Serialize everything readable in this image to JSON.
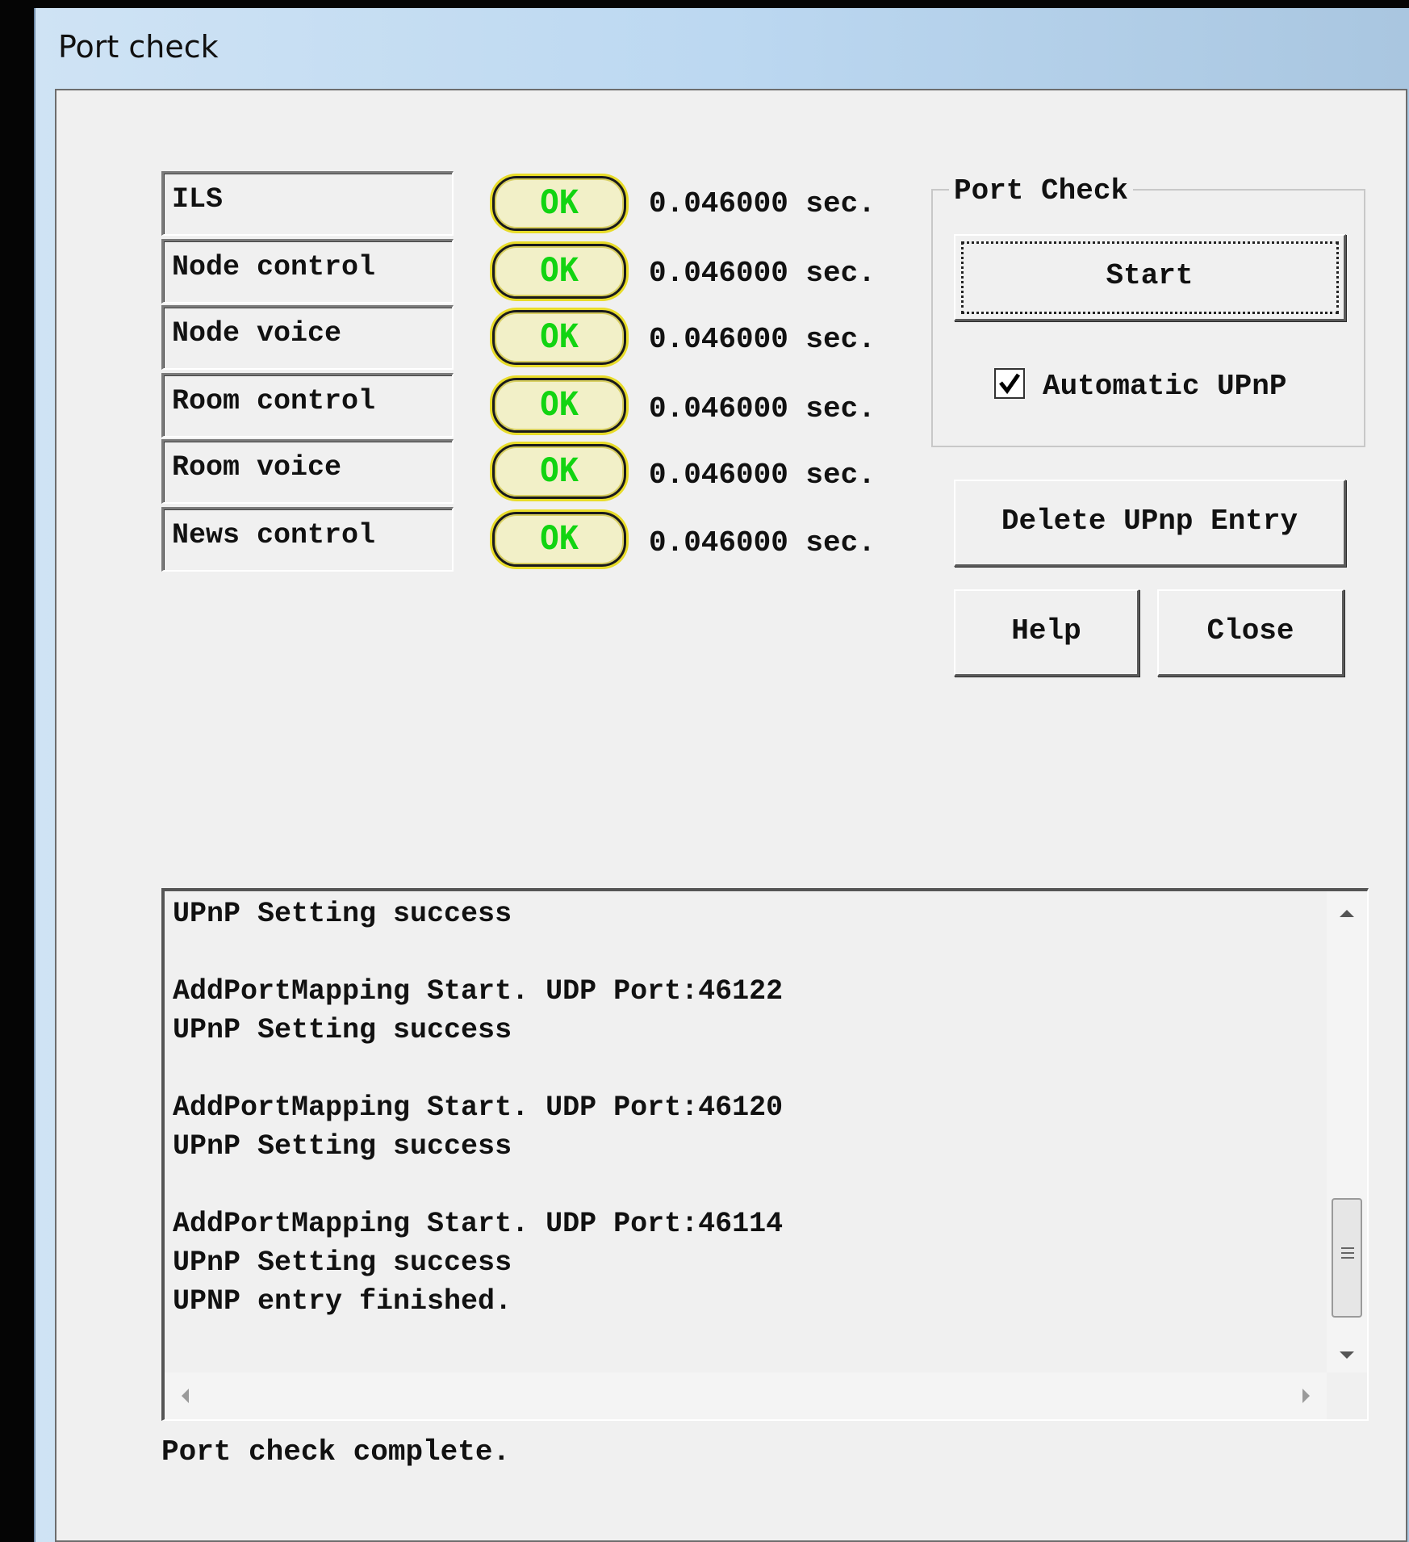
{
  "window": {
    "title": "Port check"
  },
  "services": [
    {
      "name": "ILS",
      "status": "OK",
      "time": "0.046000 sec."
    },
    {
      "name": "Node control",
      "status": "OK",
      "time": "0.046000 sec."
    },
    {
      "name": "Node voice",
      "status": "OK",
      "time": "0.046000 sec."
    },
    {
      "name": "Room control",
      "status": "OK",
      "time": "0.046000 sec."
    },
    {
      "name": "Room voice",
      "status": "OK",
      "time": "0.046000 sec."
    },
    {
      "name": "News control",
      "status": "OK",
      "time": "0.046000 sec."
    }
  ],
  "port_check_group": {
    "label": "Port Check",
    "start_label": "Start",
    "automatic_upnp_label": "Automatic UPnP",
    "automatic_upnp_checked": true
  },
  "buttons": {
    "delete_upnp": "Delete UPnp Entry",
    "help": "Help",
    "close": "Close"
  },
  "log": {
    "lines": [
      "UPnP Setting success",
      "",
      "AddPortMapping Start. UDP Port:46122",
      "UPnP Setting success",
      "",
      "AddPortMapping Start. UDP Port:46120",
      "UPnP Setting success",
      "",
      "AddPortMapping Start. UDP Port:46114",
      "UPnP Setting success",
      "UPNP entry finished."
    ]
  },
  "status_text": "Port check complete.",
  "colors": {
    "ok_text": "#12d412",
    "ok_ring": "#e8dc2a",
    "dialog_bg": "#f0f0f0"
  }
}
